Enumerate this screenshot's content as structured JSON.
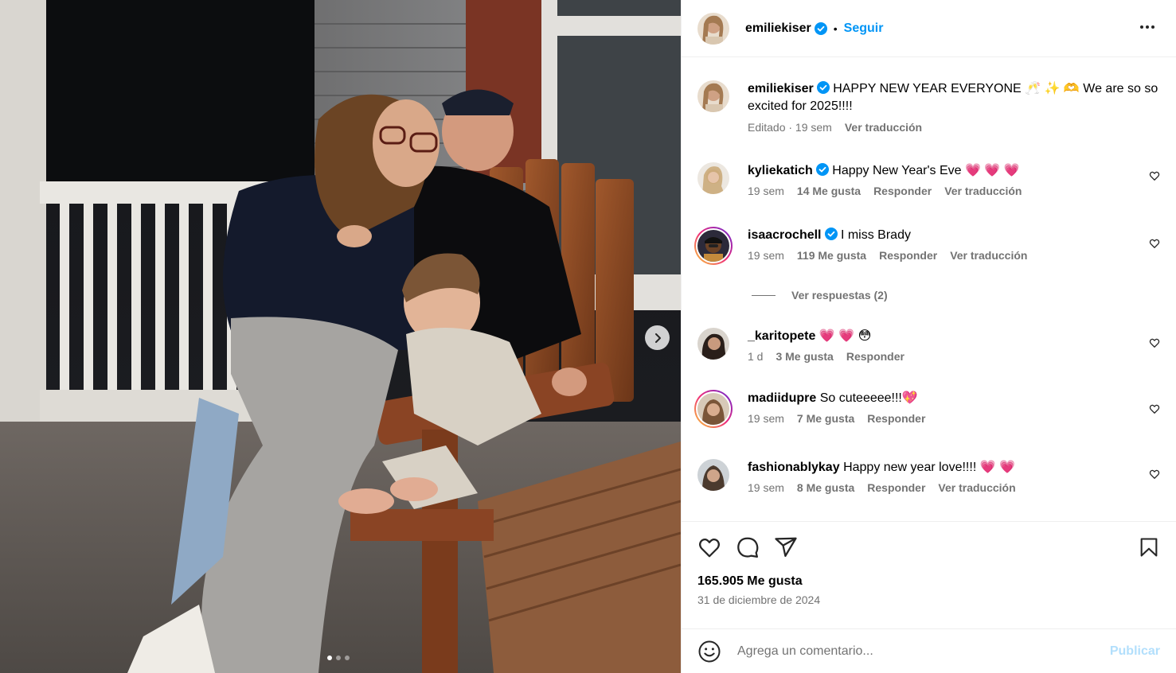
{
  "post": {
    "author": "emiliekiser",
    "follow_label": "Seguir",
    "bullet": "•",
    "more_icon": "more-horizontal-icon",
    "carousel": {
      "total": 3,
      "active": 1
    }
  },
  "caption": {
    "username": "emiliekiser",
    "text": "HAPPY NEW YEAR EVERYONE 🥂 ✨ 🫶 We are so so excited for 2025!!!!",
    "time": "Editado · 19 sem",
    "translate": "Ver traducción"
  },
  "comments": [
    {
      "username": "kyliekatich",
      "verified": true,
      "text": "Happy New Year's Eve 💗 💗 💗",
      "time": "19 sem",
      "likes": "14 Me gusta",
      "reply": "Responder",
      "translate": "Ver traducción"
    },
    {
      "username": "isaacrochell",
      "verified": true,
      "text": "I miss Brady",
      "time": "19 sem",
      "likes": "119 Me gusta",
      "reply": "Responder",
      "translate": "Ver traducción",
      "story_ring": true
    },
    {
      "username": "_karitopete",
      "verified": false,
      "text": "💗 💗 😳",
      "time": "1 d",
      "likes": "3 Me gusta",
      "reply": "Responder"
    },
    {
      "username": "madiidupre",
      "verified": false,
      "text": "So cuteeeee!!!💖",
      "time": "19 sem",
      "likes": "7 Me gusta",
      "reply": "Responder",
      "story_ring": true
    },
    {
      "username": "fashionablykay",
      "verified": false,
      "text": "Happy new year love!!!! 💗 💗",
      "time": "19 sem",
      "likes": "8 Me gusta",
      "reply": "Responder",
      "translate": "Ver traducción"
    }
  ],
  "view_replies": "Ver respuestas (2)",
  "stats": {
    "likes": "165.905 Me gusta",
    "date": "31 de diciembre de 2024"
  },
  "add_comment": {
    "placeholder": "Agrega un comentario...",
    "post_label": "Publicar",
    "emoji_icon": "emoji-smile-icon"
  },
  "colors": {
    "link_blue": "#0095f6",
    "muted": "#737373",
    "publish_disabled": "#b2dffc",
    "verified_blue": "#0095f6"
  }
}
